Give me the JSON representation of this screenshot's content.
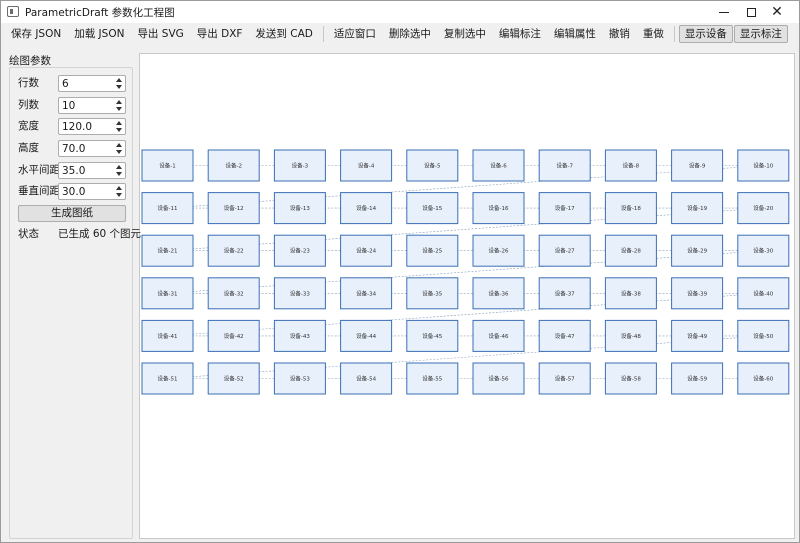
{
  "window": {
    "title": "ParametricDraft 参数化工程图"
  },
  "toolbar": {
    "items": [
      {
        "label": "保存 JSON",
        "name": "save-json-button"
      },
      {
        "label": "加载 JSON",
        "name": "load-json-button"
      },
      {
        "label": "导出 SVG",
        "name": "export-svg-button"
      },
      {
        "label": "导出 DXF",
        "name": "export-dxf-button"
      },
      {
        "label": "发送到 CAD",
        "name": "send-to-cad-button"
      },
      {
        "label": "适应窗口",
        "name": "fit-window-button",
        "sep_before": true
      },
      {
        "label": "删除选中",
        "name": "delete-selected-button"
      },
      {
        "label": "复制选中",
        "name": "copy-selected-button"
      },
      {
        "label": "编辑标注",
        "name": "edit-annotation-button"
      },
      {
        "label": "编辑属性",
        "name": "edit-properties-button"
      },
      {
        "label": "撤销",
        "name": "undo-button"
      },
      {
        "label": "重做",
        "name": "redo-button"
      },
      {
        "label": "显示设备",
        "name": "show-devices-toggle",
        "toggled": true,
        "sep_before": true
      },
      {
        "label": "显示标注",
        "name": "show-annotations-toggle",
        "toggled": true
      }
    ]
  },
  "params": {
    "group_title": "绘图参数",
    "rows": [
      {
        "label": "行数",
        "value": "6",
        "name": "rows"
      },
      {
        "label": "列数",
        "value": "10",
        "name": "columns"
      },
      {
        "label": "宽度",
        "value": "120.0",
        "name": "width"
      },
      {
        "label": "高度",
        "value": "70.0",
        "name": "height"
      },
      {
        "label": "水平间距",
        "value": "35.0",
        "name": "h-spacing"
      },
      {
        "label": "垂直间距",
        "value": "30.0",
        "name": "v-spacing"
      }
    ],
    "generate_label": "生成图纸",
    "status_label": "状态",
    "status_value": "已生成 60 个图元"
  },
  "drawing": {
    "device_prefix": "设备-",
    "rows": 6,
    "columns": 10,
    "box_fill": "#e8f0fb",
    "box_stroke": "#3a6fb5",
    "link_stroke": "#8aa0c0"
  }
}
